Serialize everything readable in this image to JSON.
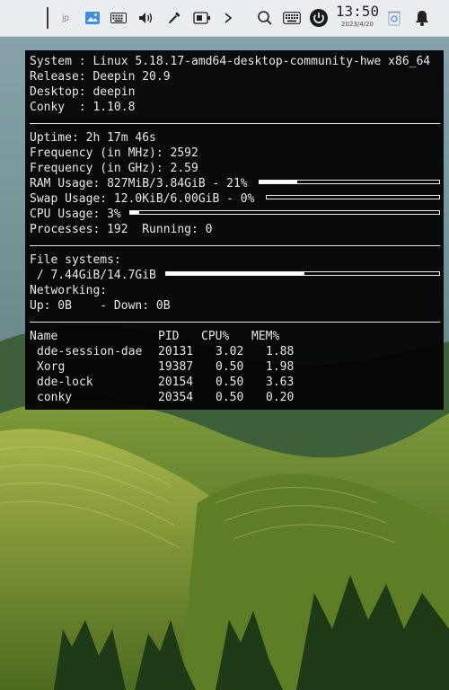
{
  "topbar": {
    "jp_label": "jp",
    "time": "13:50",
    "date": "2023/4/20"
  },
  "conky": {
    "system": "System : Linux 5.18.17-amd64-desktop-community-hwe x86_64",
    "release": "Release: Deepin 20.9",
    "desktop": "Desktop: deepin",
    "conky_ver": "Conky  : 1.10.8",
    "uptime": "Uptime: 2h 17m 46s",
    "freq_mhz": "Frequency (in MHz): 2592",
    "freq_ghz": "Frequency (in GHz): 2.59",
    "ram": "RAM Usage: 827MiB/3.84GiB - 21%",
    "ram_pct": 21,
    "swap": "Swap Usage: 12.0KiB/6.00GiB - 0%",
    "swap_pct": 0,
    "cpu": "CPU Usage: 3%",
    "cpu_pct": 3,
    "processes": "Processes: 192  Running: 0",
    "fs_title": "File systems:",
    "fs_root": " / 7.44GiB/14.7GiB",
    "fs_pct": 50.6,
    "net_title": "Networking:",
    "net": "Up: 0B    - Down: 0B",
    "proc_headers": [
      "Name",
      "PID",
      "CPU%",
      "MEM%"
    ],
    "proc_rows": [
      {
        "name": "dde-session-dae",
        "pid": "20131",
        "cpu": "3.02",
        "mem": "1.88"
      },
      {
        "name": "Xorg",
        "pid": "19387",
        "cpu": "0.50",
        "mem": "1.98"
      },
      {
        "name": "dde-lock",
        "pid": "20154",
        "cpu": "0.50",
        "mem": "3.63"
      },
      {
        "name": "conky",
        "pid": "20354",
        "cpu": "0.50",
        "mem": "0.20"
      }
    ]
  }
}
